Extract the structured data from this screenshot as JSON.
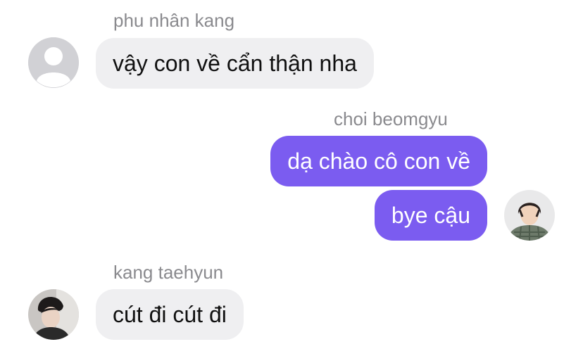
{
  "chat": {
    "messages": [
      {
        "sender": "phu nhân kang",
        "text": "vậy con về cẩn thận nha",
        "direction": "incoming",
        "avatar": "default-user-avatar"
      },
      {
        "sender": "choi beomgyu",
        "text": "dạ chào cô con về",
        "direction": "outgoing"
      },
      {
        "text": "bye cậu",
        "direction": "outgoing",
        "avatar": "profile-photo-avatar"
      },
      {
        "sender": "kang taehyun",
        "text": "cút đi cút đi",
        "direction": "incoming",
        "avatar": "profile-photo-avatar"
      }
    ]
  },
  "colors": {
    "outgoing_bubble": "#7b5cf0",
    "incoming_bubble": "#efeff1",
    "sender_name": "#8a8a8e"
  }
}
